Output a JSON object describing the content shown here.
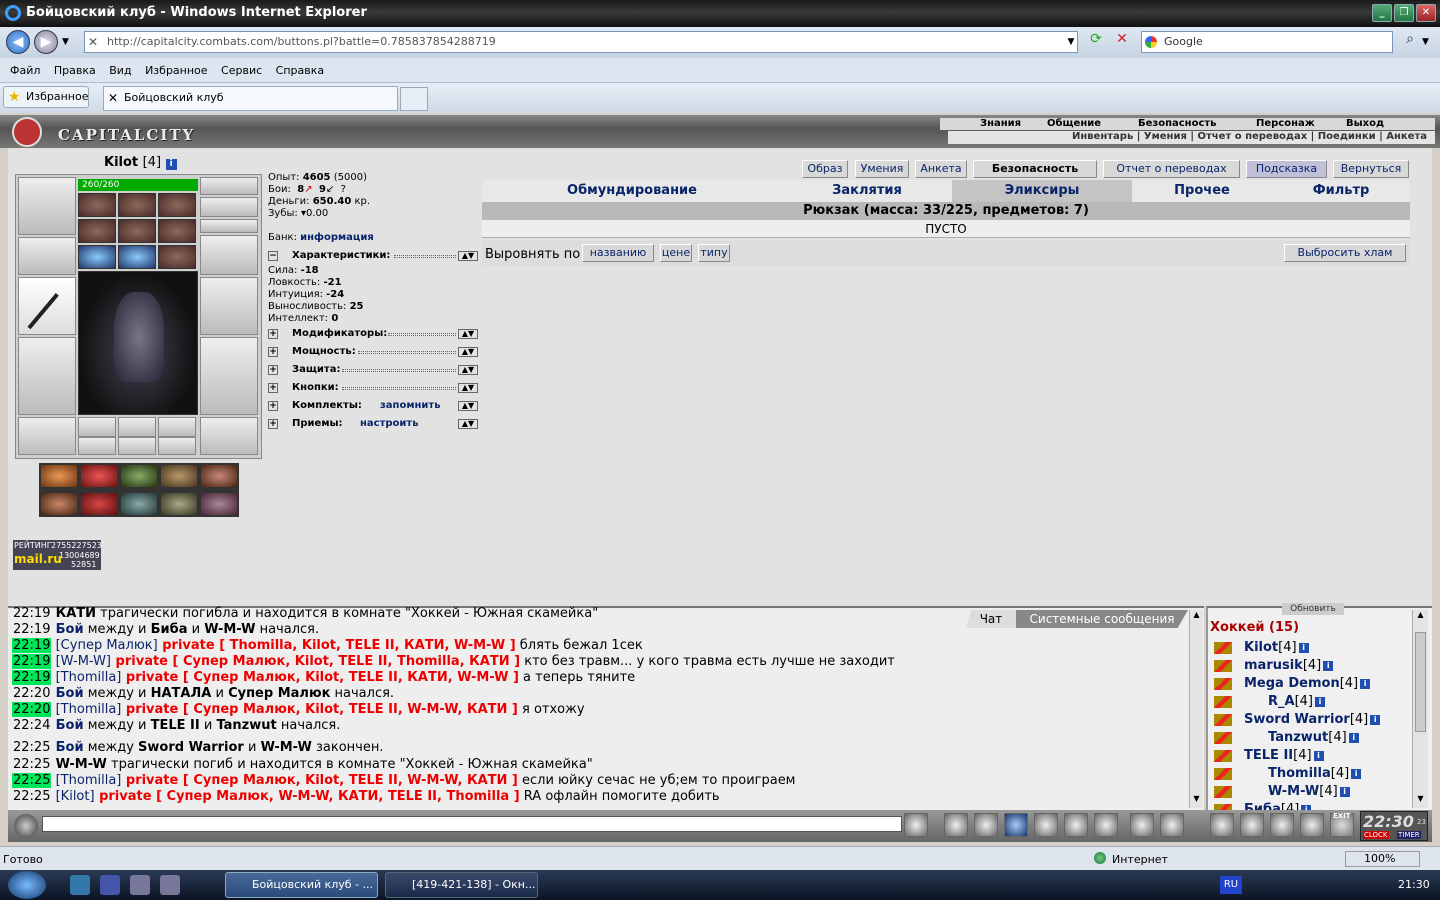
{
  "window": {
    "title": "Бойцовский клуб - Windows Internet Explorer"
  },
  "address": {
    "url": "http://capitalcity.combats.com/buttons.pl?battle=0.785837854288719",
    "search_placeholder": "Google"
  },
  "menu": [
    "Файл",
    "Правка",
    "Вид",
    "Избранное",
    "Сервис",
    "Справка"
  ],
  "favorites": {
    "label": "Избранное",
    "tab": "Бойцовский клуб"
  },
  "game": {
    "logo": "CAPITALCITY",
    "topnav": [
      "Знания",
      "Общение",
      "Безопасность",
      "Персонаж",
      "Выход"
    ],
    "subnav": "Инвентарь | Умения | Отчет о переводах | Поединки | Анкета"
  },
  "character": {
    "name": "Kilot",
    "level": "[4]",
    "hp": "260/260",
    "stats": {
      "exp_label": "Опыт:",
      "exp": "4605",
      "exp_next": "(5000)",
      "fights_label": "Бои:",
      "wins": "8",
      "losses": "9",
      "draws": "?",
      "money_label": "Деньги:",
      "money": "650.40",
      "money_unit": "кр.",
      "teeth_label": "Зубы:",
      "teeth": "0.00",
      "bank_label": "Банк:",
      "bank_link": "информация"
    },
    "attrs_title": "Характеристики:",
    "attrs": [
      {
        "label": "Сила:",
        "value": "-18"
      },
      {
        "label": "Ловкость:",
        "value": "-21"
      },
      {
        "label": "Интуиция:",
        "value": "-24"
      },
      {
        "label": "Выносливость:",
        "value": "25"
      },
      {
        "label": "Интеллект:",
        "value": "0"
      }
    ],
    "sections": [
      {
        "name": "Модификаторы:",
        "link": ""
      },
      {
        "name": "Мощность:",
        "link": ""
      },
      {
        "name": "Защита:",
        "link": ""
      },
      {
        "name": "Кнопки:",
        "link": ""
      },
      {
        "name": "Комплекты:",
        "link": "запомнить"
      },
      {
        "name": "Приемы:",
        "link": "настроить"
      }
    ],
    "rating": {
      "label": "РЕЙТИНГ",
      "v1": "2755227523",
      "v2": "13004689",
      "v3": "52851",
      "brand": "mail.ru"
    }
  },
  "inventory": {
    "top_buttons": [
      "Образ",
      "Умения",
      "Анкета",
      "Безопасность",
      "Отчет о переводах",
      "Подсказка",
      "Вернуться"
    ],
    "tabs": [
      "Обмундирование",
      "Заклятия",
      "Эликсиры",
      "Прочее",
      "Фильтр"
    ],
    "backpack": "Рюкзак (масса: 33/225, предметов: 7)",
    "empty": "ПУСТО",
    "sort_label": "Выровнять по",
    "sort_buttons": [
      "названию",
      "цене",
      "типу"
    ],
    "trash_button": "Выбросить хлам"
  },
  "chat": {
    "tabs": [
      "Чат",
      "Системные сообщения"
    ],
    "lines": [
      {
        "time": "22:19",
        "hl": false,
        "parts": [
          {
            "t": "КАТИ",
            "c": "b"
          },
          {
            "t": " трагически погибла и находится в комнате \"Хоккей - Южная скамейка\"",
            "c": ""
          }
        ]
      },
      {
        "time": "22:19",
        "hl": false,
        "parts": [
          {
            "t": "Бой",
            "c": "b bl"
          },
          {
            "t": " между и ",
            "c": ""
          },
          {
            "t": "Биба",
            "c": "b"
          },
          {
            "t": " и ",
            "c": ""
          },
          {
            "t": "W-M-W",
            "c": "b"
          },
          {
            "t": " начался.",
            "c": ""
          }
        ]
      },
      {
        "time": "22:19",
        "hl": true,
        "parts": [
          {
            "t": "[Супер Малюк]",
            "c": "bl"
          },
          {
            "t": " private [ Thomilla, Kilot, TELE II, КАТИ, W-M-W ]",
            "c": "red"
          },
          {
            "t": " блять бежал 1сек",
            "c": ""
          }
        ]
      },
      {
        "time": "22:19",
        "hl": true,
        "parts": [
          {
            "t": "[W-M-W]",
            "c": "bl"
          },
          {
            "t": " private [ Супер Малюк, Kilot, TELE II, Thomilla, КАТИ ]",
            "c": "red"
          },
          {
            "t": " кто без травм... у кого травма есть лучше не заходит",
            "c": ""
          }
        ]
      },
      {
        "time": "22:19",
        "hl": true,
        "parts": [
          {
            "t": "[Thomilla]",
            "c": "bl"
          },
          {
            "t": " private [ Супер Малюк, Kilot, TELE II, КАТИ, W-M-W ]",
            "c": "red"
          },
          {
            "t": " а теперь тяните",
            "c": ""
          }
        ]
      },
      {
        "time": "22:20",
        "hl": false,
        "parts": [
          {
            "t": "Бой",
            "c": "b bl"
          },
          {
            "t": " между и ",
            "c": ""
          },
          {
            "t": "НАТАЛА",
            "c": "b"
          },
          {
            "t": " и ",
            "c": ""
          },
          {
            "t": "Супер Малюк",
            "c": "b"
          },
          {
            "t": " начался.",
            "c": ""
          }
        ]
      },
      {
        "time": "22:20",
        "hl": true,
        "parts": [
          {
            "t": "[Thomilla]",
            "c": "bl"
          },
          {
            "t": " private [ Супер Малюк, Kilot, TELE II, W-M-W, КАТИ ]",
            "c": "red"
          },
          {
            "t": " я отхожу",
            "c": ""
          }
        ]
      },
      {
        "time": "22:24",
        "hl": false,
        "parts": [
          {
            "t": "Бой",
            "c": "b bl"
          },
          {
            "t": " между и ",
            "c": ""
          },
          {
            "t": "TELE II",
            "c": "b"
          },
          {
            "t": " и ",
            "c": ""
          },
          {
            "t": "Tanzwut",
            "c": "b"
          },
          {
            "t": " начался.",
            "c": ""
          }
        ]
      },
      {
        "time": "22:25",
        "hl": false,
        "parts": [
          {
            "t": "Бой",
            "c": "b bl"
          },
          {
            "t": " между ",
            "c": ""
          },
          {
            "t": "Sword Warrior",
            "c": "b"
          },
          {
            "t": "   и ",
            "c": ""
          },
          {
            "t": "W-M-W",
            "c": "b"
          },
          {
            "t": " закончен.",
            "c": ""
          }
        ]
      },
      {
        "time": "22:25",
        "hl": false,
        "parts": [
          {
            "t": "W-M-W",
            "c": "b"
          },
          {
            "t": " трагически погиб и находится в комнате \"Хоккей - Южная скамейка\"",
            "c": ""
          }
        ]
      },
      {
        "time": "22:25",
        "hl": true,
        "parts": [
          {
            "t": "[Thomilla]",
            "c": "bl"
          },
          {
            "t": " private [ Супер Малюк, Kilot, TELE II, W-M-W, КАТИ ]",
            "c": "red"
          },
          {
            "t": " если юйку сечас не уб;ем то проиграем",
            "c": ""
          }
        ]
      },
      {
        "time": "22:25",
        "hl": false,
        "parts": [
          {
            "t": "[Kilot]",
            "c": "bl"
          },
          {
            "t": " private [ Супер Малюк, W-M-W, КАТИ, TELE II, Thomilla ]",
            "c": "red"
          },
          {
            "t": " RA офлайн помогите добить",
            "c": ""
          }
        ]
      }
    ]
  },
  "users": {
    "room_title": "Хоккей (15)",
    "refresh": "Обновить",
    "list": [
      {
        "name": "Kilot",
        "lvl": "[4]"
      },
      {
        "name": "marusik",
        "lvl": "[4]"
      },
      {
        "name": "Mega Demon",
        "lvl": "[4]"
      },
      {
        "name": "R_A",
        "lvl": "[4]"
      },
      {
        "name": "Sword Warrior",
        "lvl": "[4]"
      },
      {
        "name": "Tanzwut",
        "lvl": "[4]"
      },
      {
        "name": "TELE II",
        "lvl": "[4]"
      },
      {
        "name": "Thomilla",
        "lvl": "[4]"
      },
      {
        "name": "W-M-W",
        "lvl": "[4]"
      },
      {
        "name": "Биба",
        "lvl": "[4]"
      }
    ]
  },
  "bottom": {
    "clock": "22:30",
    "clock_sec": "23",
    "clock_label": "CLOCK",
    "timer_label": "TIMER",
    "exit": "EXIT"
  },
  "status": {
    "left": "Готово",
    "zone": "Интернет",
    "zoom": "100%"
  },
  "taskbar": {
    "task1": "Бойцовский клуб - ...",
    "task2": "[419-421-138] - Окн...",
    "lang": "RU",
    "time": "21:30"
  }
}
